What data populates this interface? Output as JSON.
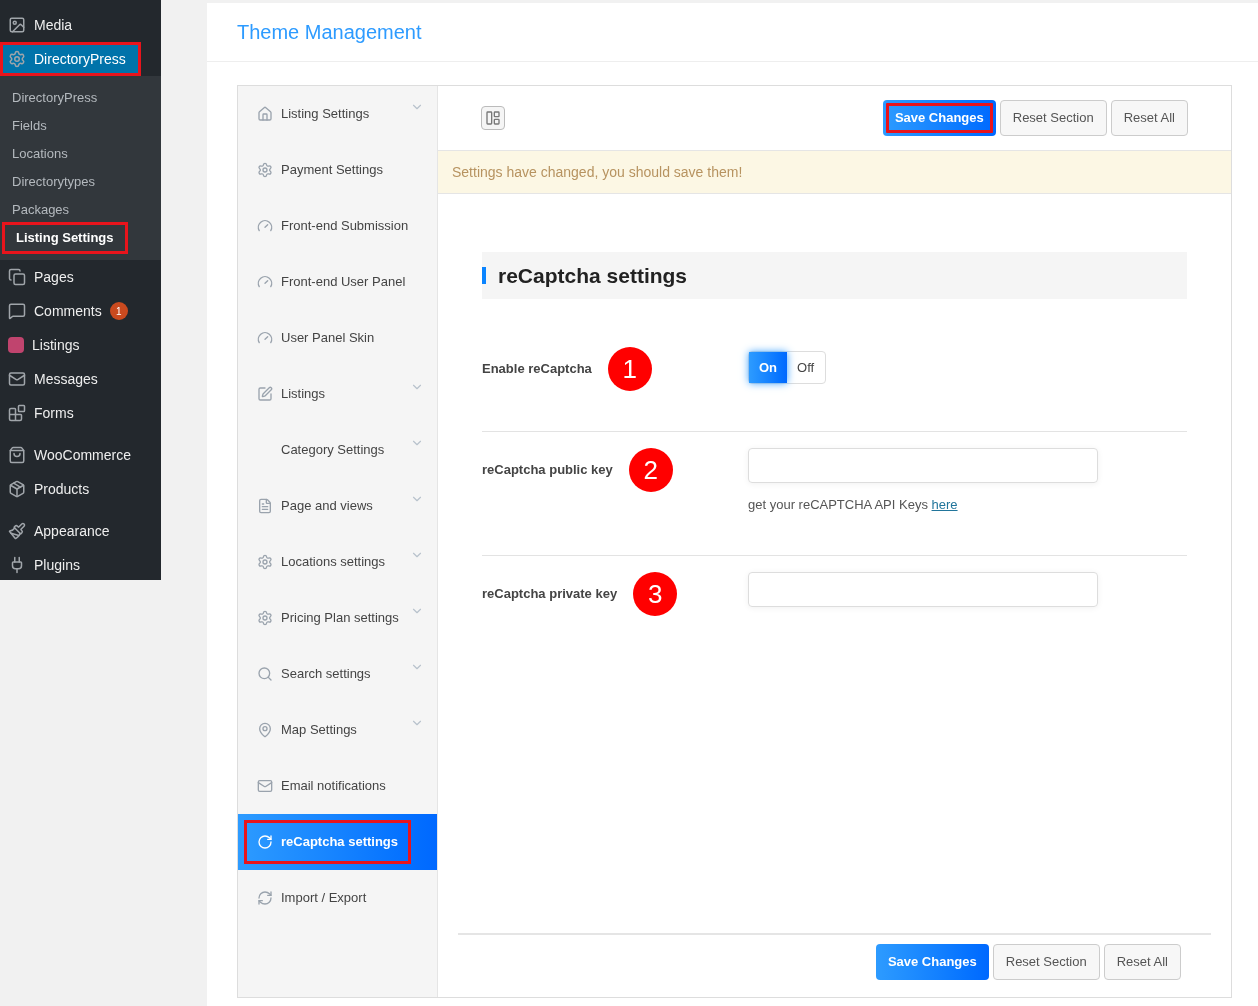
{
  "admin_menu": [
    {
      "label": "Media",
      "selected": false,
      "highlighted": false
    },
    {
      "label": "DirectoryPress",
      "selected": true,
      "highlighted": true,
      "children": [
        {
          "label": "DirectoryPress",
          "selected": false,
          "highlighted": false
        },
        {
          "label": "Fields",
          "selected": false,
          "highlighted": false
        },
        {
          "label": "Locations",
          "selected": false,
          "highlighted": false
        },
        {
          "label": "Directorytypes",
          "selected": false,
          "highlighted": false
        },
        {
          "label": "Packages",
          "selected": false,
          "highlighted": false
        },
        {
          "label": "Listing Settings",
          "selected": true,
          "highlighted": true
        }
      ]
    },
    {
      "label": "Pages",
      "selected": false,
      "highlighted": false
    },
    {
      "label": "Comments",
      "selected": false,
      "highlighted": false,
      "badge": "1"
    },
    {
      "label": "Listings",
      "selected": false,
      "highlighted": false
    },
    {
      "label": "Messages",
      "selected": false,
      "highlighted": false
    },
    {
      "label": "Forms",
      "selected": false,
      "highlighted": false
    },
    {
      "label": "WooCommerce",
      "selected": false,
      "highlighted": false
    },
    {
      "label": "Products",
      "selected": false,
      "highlighted": false
    },
    {
      "label": "Appearance",
      "selected": false,
      "highlighted": false
    },
    {
      "label": "Plugins",
      "selected": false,
      "highlighted": false
    }
  ],
  "page_title": "Theme Management",
  "options_nav": [
    {
      "label": "Listing Settings",
      "expandable": true,
      "selected": false,
      "highlighted": false
    },
    {
      "label": "Payment Settings",
      "expandable": false,
      "selected": false,
      "highlighted": false
    },
    {
      "label": "Front-end Submission",
      "expandable": false,
      "selected": false,
      "highlighted": false
    },
    {
      "label": "Front-end User Panel",
      "expandable": false,
      "selected": false,
      "highlighted": false
    },
    {
      "label": "User Panel Skin",
      "expandable": false,
      "selected": false,
      "highlighted": false
    },
    {
      "label": "Listings",
      "expandable": true,
      "selected": false,
      "highlighted": false
    },
    {
      "label": "Category Settings",
      "expandable": true,
      "selected": false,
      "highlighted": false
    },
    {
      "label": "Page and views",
      "expandable": true,
      "selected": false,
      "highlighted": false
    },
    {
      "label": "Locations settings",
      "expandable": true,
      "selected": false,
      "highlighted": false
    },
    {
      "label": "Pricing Plan settings",
      "expandable": true,
      "selected": false,
      "highlighted": false
    },
    {
      "label": "Search settings",
      "expandable": true,
      "selected": false,
      "highlighted": false
    },
    {
      "label": "Map Settings",
      "expandable": true,
      "selected": false,
      "highlighted": false
    },
    {
      "label": "Email notifications",
      "expandable": false,
      "selected": false,
      "highlighted": false
    },
    {
      "label": "reCaptcha settings",
      "expandable": false,
      "selected": true,
      "highlighted": true
    },
    {
      "label": "Import / Export",
      "expandable": false,
      "selected": false,
      "highlighted": false
    }
  ],
  "top_buttons": [
    {
      "label": "Save Changes",
      "kind": "primary",
      "highlighted": true
    },
    {
      "label": "Reset Section",
      "kind": "default",
      "highlighted": false
    },
    {
      "label": "Reset All",
      "kind": "default",
      "highlighted": false
    }
  ],
  "notice": "Settings have changed, you should save them!",
  "section_title": "reCaptcha settings",
  "fields": [
    {
      "kind": "toggle",
      "label": "Enable reCaptcha",
      "marker": "1",
      "options": [
        {
          "label": "On",
          "selected": true
        },
        {
          "label": "Off",
          "selected": false
        }
      ]
    },
    {
      "kind": "text",
      "label": "reCaptcha public key",
      "marker": "2",
      "help": "get your reCAPTCHA API Keys",
      "help_link": "here"
    },
    {
      "kind": "text",
      "label": "reCaptcha private key",
      "marker": "3"
    }
  ],
  "bottom_buttons": [
    {
      "label": "Save Changes",
      "kind": "primary",
      "highlighted": false
    },
    {
      "label": "Reset Section",
      "kind": "default",
      "highlighted": false
    },
    {
      "label": "Reset All",
      "kind": "default",
      "highlighted": false
    }
  ]
}
